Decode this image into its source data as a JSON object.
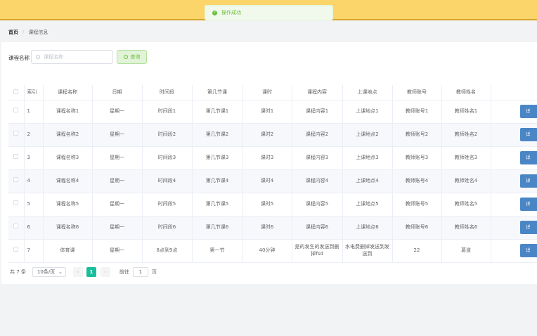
{
  "toast": {
    "message": "操作成功",
    "icon": "check-circle-icon"
  },
  "breadcrumb": {
    "home": "首页",
    "separator": "/",
    "current": "课程信息"
  },
  "search": {
    "label": "课程名称",
    "placeholder": "课程名称",
    "button_label": "查询"
  },
  "table": {
    "headers": [
      "",
      "索引",
      "课程名称",
      "日期",
      "时间段",
      "第几节课",
      "课时",
      "课程内容",
      "上课地点",
      "教师账号",
      "教师姓名",
      ""
    ],
    "rows": [
      [
        "1",
        "课程名称1",
        "星期一",
        "时间段1",
        "第几节课1",
        "课时1",
        "课程内容1",
        "上课地点1",
        "教师账号1",
        "教师姓名1"
      ],
      [
        "2",
        "课程名称2",
        "星期一",
        "时间段2",
        "第几节课2",
        "课时2",
        "课程内容2",
        "上课地点2",
        "教师账号2",
        "教师姓名2"
      ],
      [
        "3",
        "课程名称3",
        "星期一",
        "时间段3",
        "第几节课3",
        "课时3",
        "课程内容3",
        "上课地点3",
        "教师账号3",
        "教师姓名3"
      ],
      [
        "4",
        "课程名称4",
        "星期一",
        "时间段4",
        "第几节课4",
        "课时4",
        "课程内容4",
        "上课地点4",
        "教师账号4",
        "教师姓名4"
      ],
      [
        "5",
        "课程名称5",
        "星期一",
        "时间段5",
        "第几节课5",
        "课时5",
        "课程内容5",
        "上课地点5",
        "教师账号5",
        "教师姓名5"
      ],
      [
        "6",
        "课程名称6",
        "星期一",
        "时间段6",
        "第几节课6",
        "课时6",
        "课程内容6",
        "上课地点6",
        "教师账号6",
        "教师姓名6"
      ],
      [
        "7",
        "体育课",
        "星期一",
        "8点到9点",
        "第一节",
        "40分钟",
        "是的发生的发送到删掉fsd",
        "水电费删掉发送到发送到",
        "22",
        "葛道"
      ]
    ],
    "action_label": "详"
  },
  "pagination": {
    "total": "共 7 条",
    "page_size": "10条/页",
    "current_page": "1",
    "goto_prefix": "前往",
    "goto_value": "1",
    "goto_suffix": "页"
  },
  "colors": {
    "topbar": "#fbd56a",
    "success": "#67c23a",
    "accent": "#19be9b",
    "action": "#4a86c5"
  }
}
